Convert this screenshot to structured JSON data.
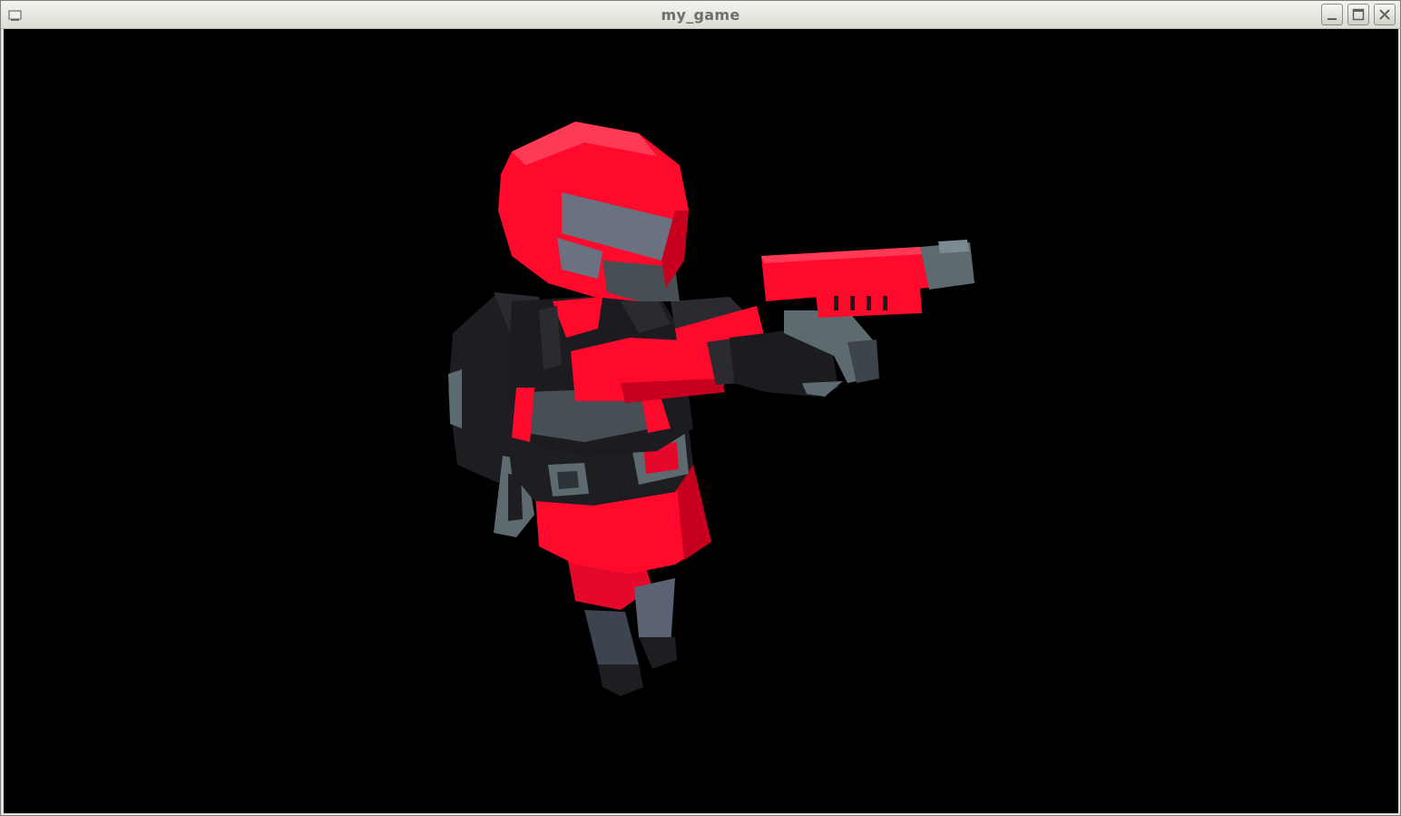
{
  "window": {
    "title": "my_game"
  },
  "icons": {
    "menu": "window-menu-icon",
    "minimize": "minimize-icon",
    "maximize": "maximize-icon",
    "close": "close-icon"
  },
  "scene": {
    "background": "#000000",
    "character": {
      "primary_color": "#ff0a2d",
      "dark_color": "#1c1c20",
      "metal_color": "#5d6a70",
      "visor_color": "#6a7180"
    }
  }
}
